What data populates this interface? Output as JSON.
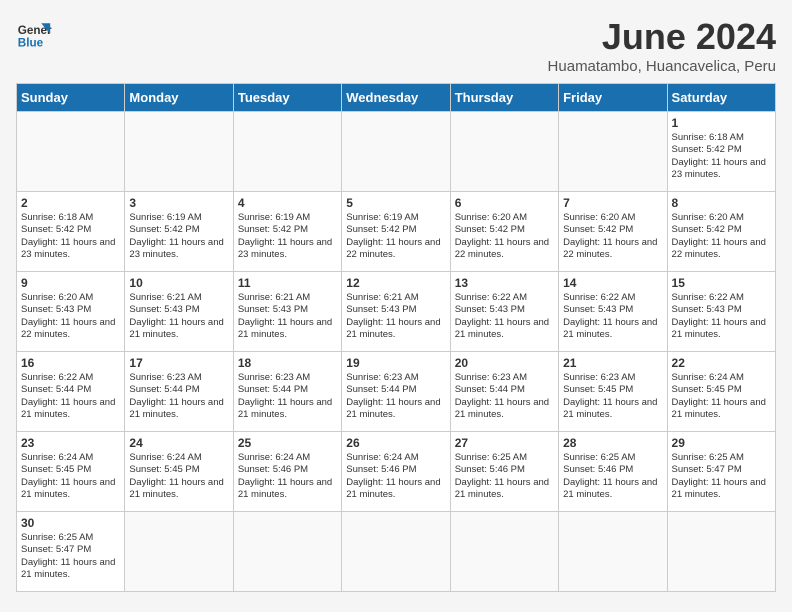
{
  "logo": {
    "text_general": "General",
    "text_blue": "Blue"
  },
  "header": {
    "month_year": "June 2024",
    "location": "Huamatambo, Huancavelica, Peru"
  },
  "days_of_week": [
    "Sunday",
    "Monday",
    "Tuesday",
    "Wednesday",
    "Thursday",
    "Friday",
    "Saturday"
  ],
  "weeks": [
    [
      {
        "day": "",
        "info": ""
      },
      {
        "day": "",
        "info": ""
      },
      {
        "day": "",
        "info": ""
      },
      {
        "day": "",
        "info": ""
      },
      {
        "day": "",
        "info": ""
      },
      {
        "day": "",
        "info": ""
      },
      {
        "day": "1",
        "info": "Sunrise: 6:18 AM\nSunset: 5:42 PM\nDaylight: 11 hours and 23 minutes."
      }
    ],
    [
      {
        "day": "2",
        "info": "Sunrise: 6:18 AM\nSunset: 5:42 PM\nDaylight: 11 hours and 23 minutes."
      },
      {
        "day": "3",
        "info": "Sunrise: 6:19 AM\nSunset: 5:42 PM\nDaylight: 11 hours and 23 minutes."
      },
      {
        "day": "4",
        "info": "Sunrise: 6:19 AM\nSunset: 5:42 PM\nDaylight: 11 hours and 23 minutes."
      },
      {
        "day": "5",
        "info": "Sunrise: 6:19 AM\nSunset: 5:42 PM\nDaylight: 11 hours and 22 minutes."
      },
      {
        "day": "6",
        "info": "Sunrise: 6:20 AM\nSunset: 5:42 PM\nDaylight: 11 hours and 22 minutes."
      },
      {
        "day": "7",
        "info": "Sunrise: 6:20 AM\nSunset: 5:42 PM\nDaylight: 11 hours and 22 minutes."
      },
      {
        "day": "8",
        "info": "Sunrise: 6:20 AM\nSunset: 5:42 PM\nDaylight: 11 hours and 22 minutes."
      }
    ],
    [
      {
        "day": "9",
        "info": "Sunrise: 6:20 AM\nSunset: 5:43 PM\nDaylight: 11 hours and 22 minutes."
      },
      {
        "day": "10",
        "info": "Sunrise: 6:21 AM\nSunset: 5:43 PM\nDaylight: 11 hours and 21 minutes."
      },
      {
        "day": "11",
        "info": "Sunrise: 6:21 AM\nSunset: 5:43 PM\nDaylight: 11 hours and 21 minutes."
      },
      {
        "day": "12",
        "info": "Sunrise: 6:21 AM\nSunset: 5:43 PM\nDaylight: 11 hours and 21 minutes."
      },
      {
        "day": "13",
        "info": "Sunrise: 6:22 AM\nSunset: 5:43 PM\nDaylight: 11 hours and 21 minutes."
      },
      {
        "day": "14",
        "info": "Sunrise: 6:22 AM\nSunset: 5:43 PM\nDaylight: 11 hours and 21 minutes."
      },
      {
        "day": "15",
        "info": "Sunrise: 6:22 AM\nSunset: 5:43 PM\nDaylight: 11 hours and 21 minutes."
      }
    ],
    [
      {
        "day": "16",
        "info": "Sunrise: 6:22 AM\nSunset: 5:44 PM\nDaylight: 11 hours and 21 minutes."
      },
      {
        "day": "17",
        "info": "Sunrise: 6:23 AM\nSunset: 5:44 PM\nDaylight: 11 hours and 21 minutes."
      },
      {
        "day": "18",
        "info": "Sunrise: 6:23 AM\nSunset: 5:44 PM\nDaylight: 11 hours and 21 minutes."
      },
      {
        "day": "19",
        "info": "Sunrise: 6:23 AM\nSunset: 5:44 PM\nDaylight: 11 hours and 21 minutes."
      },
      {
        "day": "20",
        "info": "Sunrise: 6:23 AM\nSunset: 5:44 PM\nDaylight: 11 hours and 21 minutes."
      },
      {
        "day": "21",
        "info": "Sunrise: 6:23 AM\nSunset: 5:45 PM\nDaylight: 11 hours and 21 minutes."
      },
      {
        "day": "22",
        "info": "Sunrise: 6:24 AM\nSunset: 5:45 PM\nDaylight: 11 hours and 21 minutes."
      }
    ],
    [
      {
        "day": "23",
        "info": "Sunrise: 6:24 AM\nSunset: 5:45 PM\nDaylight: 11 hours and 21 minutes."
      },
      {
        "day": "24",
        "info": "Sunrise: 6:24 AM\nSunset: 5:45 PM\nDaylight: 11 hours and 21 minutes."
      },
      {
        "day": "25",
        "info": "Sunrise: 6:24 AM\nSunset: 5:46 PM\nDaylight: 11 hours and 21 minutes."
      },
      {
        "day": "26",
        "info": "Sunrise: 6:24 AM\nSunset: 5:46 PM\nDaylight: 11 hours and 21 minutes."
      },
      {
        "day": "27",
        "info": "Sunrise: 6:25 AM\nSunset: 5:46 PM\nDaylight: 11 hours and 21 minutes."
      },
      {
        "day": "28",
        "info": "Sunrise: 6:25 AM\nSunset: 5:46 PM\nDaylight: 11 hours and 21 minutes."
      },
      {
        "day": "29",
        "info": "Sunrise: 6:25 AM\nSunset: 5:47 PM\nDaylight: 11 hours and 21 minutes."
      }
    ],
    [
      {
        "day": "30",
        "info": "Sunrise: 6:25 AM\nSunset: 5:47 PM\nDaylight: 11 hours and 21 minutes."
      },
      {
        "day": "",
        "info": ""
      },
      {
        "day": "",
        "info": ""
      },
      {
        "day": "",
        "info": ""
      },
      {
        "day": "",
        "info": ""
      },
      {
        "day": "",
        "info": ""
      },
      {
        "day": "",
        "info": ""
      }
    ]
  ]
}
